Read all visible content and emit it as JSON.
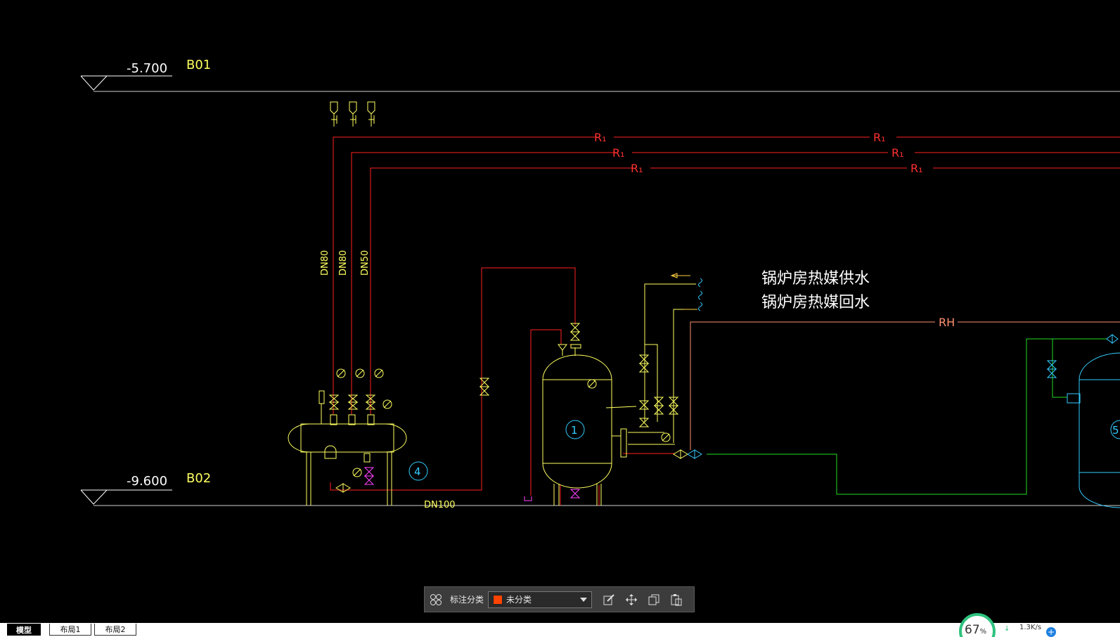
{
  "drawing": {
    "levels": [
      {
        "elevation": "-5.700",
        "tag": "B01"
      },
      {
        "elevation": "-9.600",
        "tag": "B02"
      }
    ],
    "pipe_labels": [
      "R₁",
      "R₁",
      "R₁",
      "R₁",
      "R₁",
      "R₁"
    ],
    "rh_label": "RH",
    "riser_sizes": [
      "DN80",
      "DN80",
      "DN50"
    ],
    "main_size": "DN100",
    "notes": [
      "锅炉房热媒供水",
      "锅炉房热媒回水"
    ],
    "equipment_tags": [
      "1",
      "4",
      "5"
    ],
    "colors": {
      "background": "#000000",
      "supply_pipe": "#ff2020",
      "equipment": "#ffff60",
      "valve_cyan": "#33ccff",
      "green_pipe": "#22dd22",
      "text_white": "#ffffff",
      "rh_pipe": "#ff9070"
    }
  },
  "toolbar": {
    "category_label": "标注分类",
    "selected_category": "未分类",
    "swatch_color": "#ff4400",
    "icons": [
      "grid-icon",
      "edit-icon",
      "move-icon",
      "copy-icon",
      "paste-icon"
    ]
  },
  "tabs": [
    {
      "label": "模型",
      "active": true
    },
    {
      "label": "布局1",
      "active": false
    },
    {
      "label": "布局2",
      "active": false
    }
  ],
  "status": {
    "usage_percent": "67",
    "percent_sign": "%",
    "net_speed": "1.3K/s"
  }
}
